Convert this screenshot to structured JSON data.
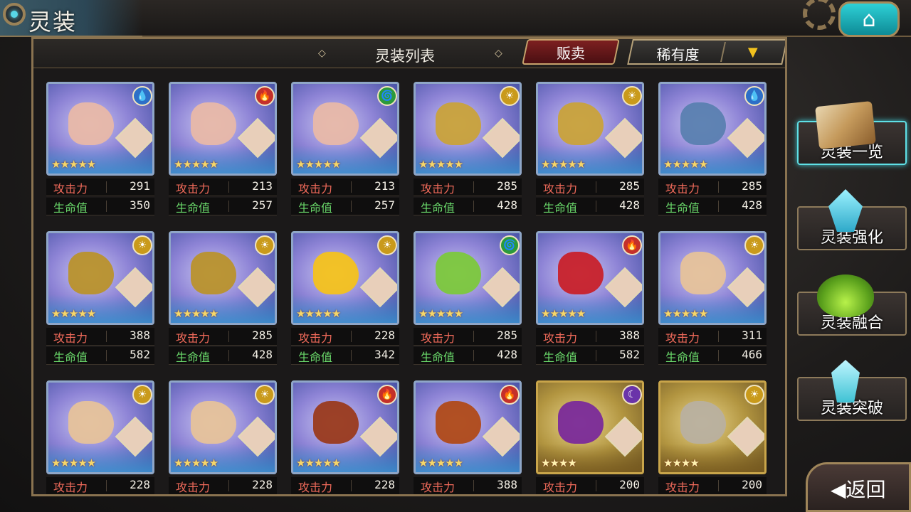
{
  "header": {
    "title": "灵装",
    "home_icon": "home-icon"
  },
  "list_header": {
    "title": "灵装列表",
    "sell_label": "贩卖",
    "sort_value": "稀有度",
    "sort_dropdown_icon": "triangle-down-icon"
  },
  "stat_labels": {
    "atk": "攻击力",
    "hp": "生命值"
  },
  "cards": [
    {
      "element": "water",
      "element_glyph": "💧",
      "stars": "★★★★★",
      "atk": "291",
      "hp": "350",
      "item_color": "#e8b8a8",
      "frame": "silver"
    },
    {
      "element": "fire",
      "element_glyph": "🔥",
      "stars": "★★★★★",
      "atk": "213",
      "hp": "257",
      "item_color": "#e8b8a8",
      "frame": "silver"
    },
    {
      "element": "wind",
      "element_glyph": "🌀",
      "stars": "★★★★★",
      "atk": "213",
      "hp": "257",
      "item_color": "#e8b8a8",
      "frame": "silver"
    },
    {
      "element": "light",
      "element_glyph": "☀",
      "stars": "★★★★★",
      "atk": "285",
      "hp": "428",
      "item_color": "#c9a23a",
      "frame": "silver"
    },
    {
      "element": "light",
      "element_glyph": "☀",
      "stars": "★★★★★",
      "atk": "285",
      "hp": "428",
      "item_color": "#c9a23a",
      "frame": "silver"
    },
    {
      "element": "water",
      "element_glyph": "💧",
      "stars": "★★★★★",
      "atk": "285",
      "hp": "428",
      "item_color": "#5a7fb0",
      "frame": "silver"
    },
    {
      "element": "light",
      "element_glyph": "☀",
      "stars": "★★★★★",
      "atk": "388",
      "hp": "582",
      "item_color": "#b9922c",
      "frame": "silver"
    },
    {
      "element": "light",
      "element_glyph": "☀",
      "stars": "★★★★★",
      "atk": "285",
      "hp": "428",
      "item_color": "#b9922c",
      "frame": "silver"
    },
    {
      "element": "light",
      "element_glyph": "☀",
      "stars": "★★★★★",
      "atk": "228",
      "hp": "342",
      "item_color": "#f4c21c",
      "frame": "silver"
    },
    {
      "element": "wind",
      "element_glyph": "🌀",
      "stars": "★★★★★",
      "atk": "285",
      "hp": "428",
      "item_color": "#7cc83c",
      "frame": "silver"
    },
    {
      "element": "fire",
      "element_glyph": "🔥",
      "stars": "★★★★★",
      "atk": "388",
      "hp": "582",
      "item_color": "#c8212a",
      "frame": "silver"
    },
    {
      "element": "light",
      "element_glyph": "☀",
      "stars": "★★★★★",
      "atk": "311",
      "hp": "466",
      "item_color": "#e6c29a",
      "frame": "silver"
    },
    {
      "element": "light",
      "element_glyph": "☀",
      "stars": "★★★★★",
      "atk": "228",
      "hp": "",
      "item_color": "#e6c29a",
      "frame": "silver"
    },
    {
      "element": "light",
      "element_glyph": "☀",
      "stars": "★★★★★",
      "atk": "228",
      "hp": "",
      "item_color": "#e6c29a",
      "frame": "silver"
    },
    {
      "element": "fire",
      "element_glyph": "🔥",
      "stars": "★★★★★",
      "atk": "228",
      "hp": "",
      "item_color": "#9a3a1c",
      "frame": "silver"
    },
    {
      "element": "fire",
      "element_glyph": "🔥",
      "stars": "★★★★★",
      "atk": "388",
      "hp": "",
      "item_color": "#b04a18",
      "frame": "silver"
    },
    {
      "element": "dark",
      "element_glyph": "☾",
      "stars": "★★★★",
      "atk": "200",
      "hp": "",
      "item_color": "#7a2a9a",
      "frame": "gold"
    },
    {
      "element": "light",
      "element_glyph": "☀",
      "stars": "★★★★",
      "atk": "200",
      "hp": "",
      "item_color": "#b8b0a0",
      "frame": "gold"
    }
  ],
  "side_menu": [
    {
      "label": "灵装一览",
      "icon": "book-icon",
      "active": true
    },
    {
      "label": "灵装强化",
      "icon": "crystal-icon",
      "active": false
    },
    {
      "label": "灵装融合",
      "icon": "flask-icon",
      "active": false
    },
    {
      "label": "灵装突破",
      "icon": "gem-icon",
      "active": false
    }
  ],
  "back_button": {
    "label": "返回",
    "icon": "back-arrow-icon"
  }
}
